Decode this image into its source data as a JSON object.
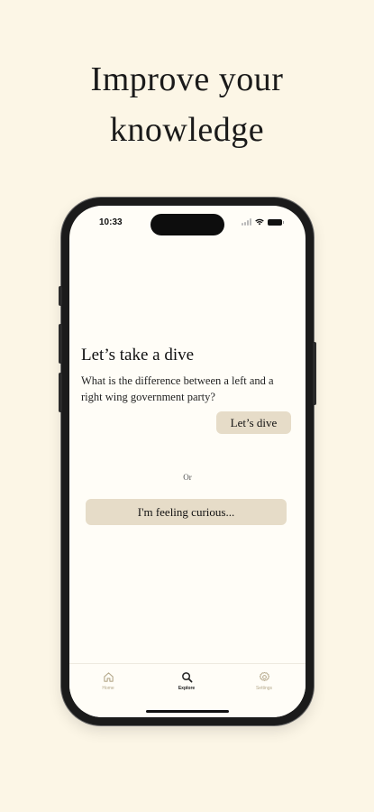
{
  "headline": {
    "line1": "Improve your",
    "line2": "knowledge"
  },
  "status_bar": {
    "time": "10:33"
  },
  "dive_card": {
    "title": "Let’s take a dive",
    "question": "What is the difference between a left and a right wing government party?",
    "button_label": "Let’s dive"
  },
  "divider_text": "Or",
  "curious_button_label": "I'm feeling curious...",
  "tabs": [
    {
      "label": "Home",
      "icon": "home-icon",
      "active": false
    },
    {
      "label": "Explore",
      "icon": "search-icon",
      "active": true
    },
    {
      "label": "Settings",
      "icon": "gear-icon",
      "active": false
    }
  ],
  "colors": {
    "background": "#fcf6e6",
    "button": "#e6dcc8",
    "inactive_tab": "#b5a98c"
  }
}
